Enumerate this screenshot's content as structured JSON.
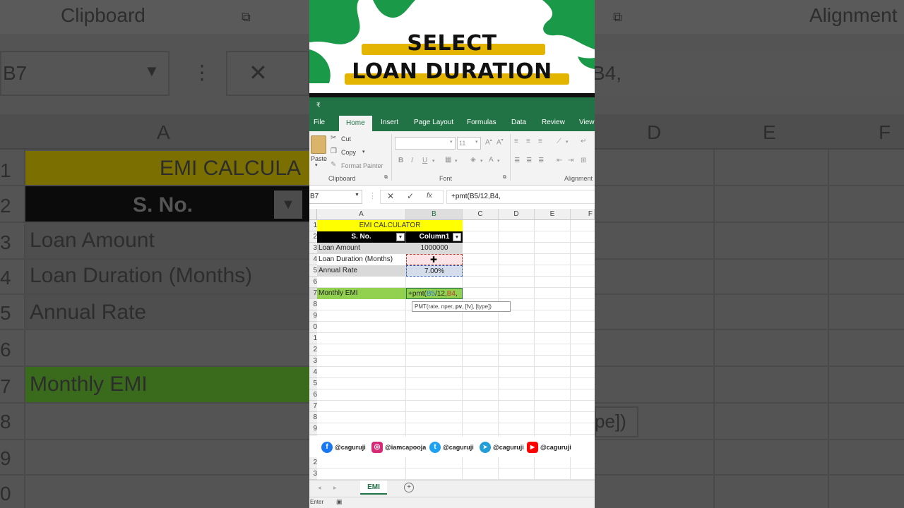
{
  "banner": {
    "title_line1": "SELECT",
    "title_line2": "LOAN DURATION"
  },
  "ribbon": {
    "qat_glyph": "₹",
    "tabs": [
      "File",
      "Home",
      "Insert",
      "Page Layout",
      "Formulas",
      "Data",
      "Review",
      "View"
    ],
    "active_tab": "Home",
    "clipboard": {
      "paste": "Paste",
      "cut": "Cut",
      "copy": "Copy",
      "format_painter": "Format Painter",
      "group": "Clipboard"
    },
    "font": {
      "size": "11",
      "group": "Font"
    },
    "alignment_group": "Alignment"
  },
  "formula_bar": {
    "name_box": "B7",
    "fx": "fx",
    "formula": "+pmt(B5/12,B4,"
  },
  "grid": {
    "columns": [
      "A",
      "B",
      "C",
      "D",
      "E",
      "F"
    ],
    "rows": [
      "1",
      "2",
      "3",
      "4",
      "5",
      "6",
      "7",
      "8",
      "9",
      "0",
      "1",
      "2",
      "3",
      "4",
      "5",
      "6",
      "7",
      "8",
      "9",
      "0",
      "1",
      "2",
      "3"
    ],
    "title": "EMI CALCULATOR",
    "header_a": "S. No.",
    "header_b": "Column1",
    "rows_data": [
      {
        "label": "Loan Amount",
        "value": "1000000"
      },
      {
        "label": "Loan Duration (Months)",
        "value": ""
      },
      {
        "label": "Annual Rate",
        "value": "7.00%"
      }
    ],
    "emi_label": "Monthly EMI",
    "emi_formula_parts": [
      "+pmt(",
      "B5",
      "/12,",
      "B4",
      ","
    ],
    "tooltip": {
      "prefix": "PMT(rate, nper, ",
      "bold": "pv",
      "suffix": ", [fv], [type])"
    }
  },
  "social": [
    {
      "icon": "facebook-icon",
      "handle": "@caguruji",
      "color": "#1877f2",
      "glyph": "f"
    },
    {
      "icon": "instagram-icon",
      "handle": "@iamcapooja",
      "color": "#d62976",
      "glyph": "◎"
    },
    {
      "icon": "twitter-icon",
      "handle": "@caguruji",
      "color": "#1da1f2",
      "glyph": "t"
    },
    {
      "icon": "telegram-icon",
      "handle": "@caguruji",
      "color": "#229ed9",
      "glyph": "➤"
    },
    {
      "icon": "youtube-icon",
      "handle": "@caguruji",
      "color": "#ff0000",
      "glyph": "▶"
    }
  ],
  "sheet_tab": "EMI",
  "status": "Enter",
  "background": {
    "clipboard": "Clipboard",
    "alignment": "Alignment",
    "name_box": "B7",
    "col_a": "A",
    "col_d": "D",
    "col_e": "E",
    "col_f": "F",
    "title": "EMI CALCULA",
    "sno": "S. No.",
    "loan_amount": "Loan Amount",
    "loan_duration": "Loan Duration (Months)",
    "annual_rate": "Annual Rate",
    "monthly_emi": "Monthly EMI",
    "formula_tail": "B4,",
    "tooltip_tail": "pe])",
    "rows": [
      "1",
      "2",
      "3",
      "4",
      "5",
      "6",
      "7",
      "8",
      "9",
      "0"
    ]
  }
}
